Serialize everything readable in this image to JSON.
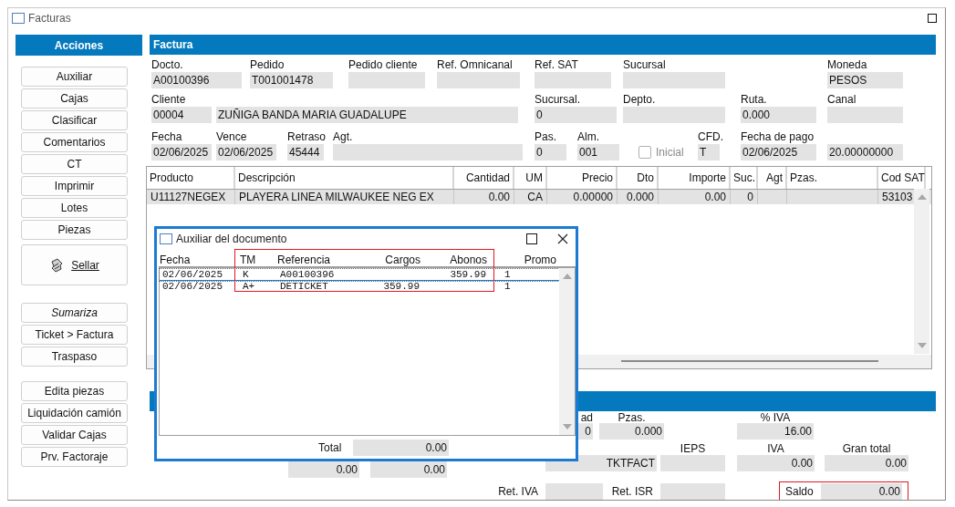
{
  "window": {
    "title": "Facturas"
  },
  "actions": {
    "title": "Acciones",
    "groups": [
      [
        {
          "label": "Auxiliar",
          "kind": "normal",
          "italic": false
        },
        {
          "label": "Cajas",
          "kind": "normal",
          "italic": false
        },
        {
          "label": "Clasificar",
          "kind": "normal",
          "italic": false
        },
        {
          "label": "Comentarios",
          "kind": "normal",
          "italic": false
        },
        {
          "label": "CT",
          "kind": "normal",
          "italic": false
        },
        {
          "label": "Imprimir",
          "kind": "normal",
          "italic": false
        },
        {
          "label": "Lotes",
          "kind": "normal",
          "italic": false
        },
        {
          "label": "Piezas",
          "kind": "normal",
          "italic": false
        },
        {
          "label": "Sellar",
          "kind": "large",
          "italic": false
        }
      ],
      [
        {
          "label": "Sumariza",
          "kind": "normal",
          "italic": true
        },
        {
          "label": "Ticket > Factura",
          "kind": "normal",
          "italic": false
        },
        {
          "label": "Traspaso",
          "kind": "normal",
          "italic": false
        }
      ],
      [
        {
          "label": "Edita piezas",
          "kind": "normal",
          "italic": false
        },
        {
          "label": "Liquidación camión",
          "kind": "normal",
          "italic": false
        },
        {
          "label": "Validar Cajas",
          "kind": "normal",
          "italic": false
        },
        {
          "label": "Prv. Factoraje",
          "kind": "normal",
          "italic": false
        }
      ]
    ]
  },
  "invoice": {
    "title": "Factura",
    "fields": [
      {
        "kind": "field",
        "label": "Docto.",
        "value": "A00100396"
      },
      {
        "kind": "field",
        "label": "Pedido",
        "value": "T001001478"
      },
      {
        "kind": "field",
        "label": "Pedido cliente"
      },
      {
        "kind": "field",
        "label": "Ref. Omnicanal"
      },
      {
        "kind": "field",
        "label": "Ref. SAT"
      },
      {
        "kind": "field",
        "label": "Sucursal"
      },
      {
        "kind": "field",
        "label": "Moneda",
        "value": "PESOS"
      },
      {
        "kind": "field",
        "label": "Cliente",
        "value": "00004"
      },
      {
        "kind": "field",
        "value": "ZUÑIGA BANDA MARIA GUADALUPE"
      },
      {
        "kind": "field",
        "label": "Sucursal.",
        "value": "0"
      },
      {
        "kind": "field",
        "label": "Depto."
      },
      {
        "kind": "field",
        "label": "Ruta.",
        "value": "0.000"
      },
      {
        "kind": "field",
        "label": "Canal"
      },
      {
        "kind": "field",
        "label": "Fecha",
        "value": "02/06/2025"
      },
      {
        "kind": "field",
        "label": "Vence",
        "value": "02/06/2025"
      },
      {
        "kind": "field",
        "label": "Retraso",
        "value": "45444"
      },
      {
        "kind": "field",
        "label": "Agt."
      },
      {
        "kind": "field",
        "label": "Pas.",
        "value": "0"
      },
      {
        "kind": "field",
        "label": "Alm.",
        "value": "001"
      },
      {
        "kind": "checkbox",
        "label": "Inicial",
        "checked": false,
        "disabled": true
      },
      {
        "kind": "field",
        "label": "CFD.",
        "value": "T"
      },
      {
        "kind": "field",
        "label": "Fecha de pago",
        "value": "02/06/2025"
      },
      {
        "kind": "field",
        "value": "20.00000000"
      }
    ]
  },
  "table": {
    "columns": [
      "Producto",
      "Descripción",
      "Cantidad",
      "UM",
      "Precio",
      "Dto",
      "Importe",
      "Suc.",
      "Agt",
      "Pzas.",
      "Cod SAT"
    ],
    "rows": [
      {
        "selected": true,
        "cells": [
          "U11127NEGEX",
          "PLAYERA LINEA MILWAUKEE NEG EX",
          "0.00",
          "CA",
          "0.00000",
          "0.000",
          "0.00",
          "0",
          "",
          "",
          "53103"
        ]
      }
    ]
  },
  "totals": {
    "fields": [
      {
        "kind": "field",
        "label": "ad",
        "value": "0",
        "highlighted": false
      },
      {
        "kind": "field",
        "label": "Pzas.",
        "value": "0.000",
        "highlighted": false
      },
      {
        "kind": "field",
        "label": "% IVA",
        "value": "16.00",
        "highlighted": false
      },
      {
        "kind": "field",
        "value": "0.00",
        "highlighted": false
      },
      {
        "kind": "field",
        "value": "0.00",
        "highlighted": false
      },
      {
        "kind": "field",
        "value": "TKTFACT",
        "highlighted": false
      },
      {
        "kind": "field",
        "label": "IEPS",
        "highlighted": false
      },
      {
        "kind": "field",
        "label": "IVA",
        "value": "0.00",
        "highlighted": false
      },
      {
        "kind": "field",
        "label": "Gran total",
        "value": "0.00",
        "highlighted": false
      },
      {
        "kind": "inline",
        "label": "Ret. IVA",
        "highlighted": false
      },
      {
        "kind": "inline",
        "label": "Ret. ISR",
        "highlighted": false
      },
      {
        "kind": "inline",
        "label": "Saldo",
        "value": "0.00",
        "highlighted": true
      }
    ]
  },
  "dialog": {
    "title": "Auxiliar del documento",
    "columns": [
      {
        "label": "Fecha",
        "highlighted": false
      },
      {
        "label": "TM",
        "highlighted": true
      },
      {
        "label": "Referencia",
        "highlighted": true
      },
      {
        "label": "Cargos",
        "highlighted": true
      },
      {
        "label": "Abonos",
        "highlighted": true
      },
      {
        "label": "Promo",
        "highlighted": false
      }
    ],
    "rows": [
      {
        "selected": true,
        "cells": [
          "02/06/2025",
          "K",
          "A00100396",
          "",
          "359.99",
          "1"
        ]
      },
      {
        "selected": false,
        "cells": [
          "02/06/2025",
          "A+",
          "DETICKET",
          "359.99",
          "",
          "1"
        ]
      }
    ],
    "total": {
      "label": "Total",
      "value": "0.00"
    }
  }
}
